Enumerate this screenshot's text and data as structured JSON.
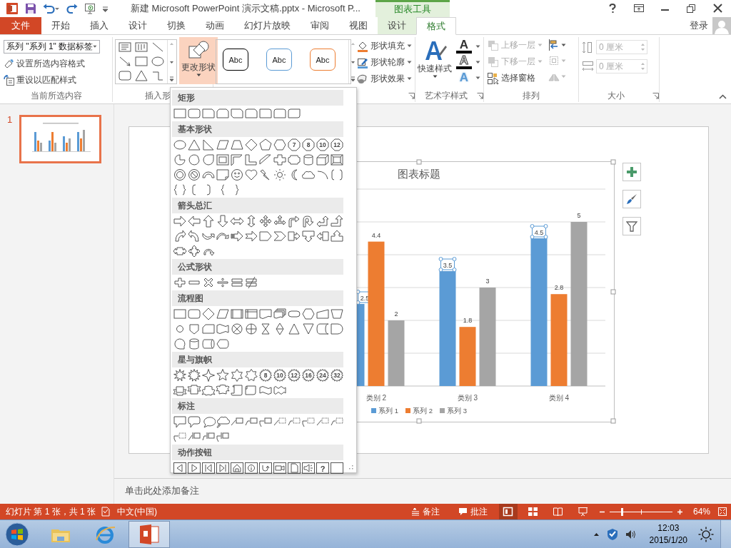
{
  "title_bar": {
    "title": "新建 Microsoft PowerPoint 演示文稿.pptx - Microsoft P...",
    "context_group": "图表工具"
  },
  "tabs": [
    {
      "label": "文件",
      "kind": "file",
      "selected": false
    },
    {
      "label": "开始",
      "kind": "normal",
      "selected": false
    },
    {
      "label": "插入",
      "kind": "normal",
      "selected": false
    },
    {
      "label": "设计",
      "kind": "normal",
      "selected": false
    },
    {
      "label": "切换",
      "kind": "normal",
      "selected": false
    },
    {
      "label": "动画",
      "kind": "normal",
      "selected": false
    },
    {
      "label": "幻灯片放映",
      "kind": "normal",
      "selected": false
    },
    {
      "label": "审阅",
      "kind": "normal",
      "selected": false
    },
    {
      "label": "视图",
      "kind": "normal",
      "selected": false
    },
    {
      "label": "设计",
      "kind": "context",
      "selected": false
    },
    {
      "label": "格式",
      "kind": "context",
      "selected": true
    }
  ],
  "account": {
    "label": "登录"
  },
  "ribbon": {
    "current_selection": {
      "dropdown": "系列 \"系列 1\" 数据标签",
      "commands": [
        {
          "label": "设置所选内容格式",
          "kind": "format"
        },
        {
          "label": "重设以匹配样式",
          "kind": "reset"
        }
      ],
      "label": "当前所选内容"
    },
    "insert_shapes": {
      "change_shape": {
        "label": "更改形状",
        "pressed": true
      },
      "label": "插入形"
    },
    "shape_styles": {
      "presets": [
        {
          "text": "Abc",
          "color": "#000000"
        },
        {
          "text": "Abc",
          "color": "#5b9bd5"
        },
        {
          "text": "Abc",
          "color": "#ed7d31"
        }
      ],
      "commands": [
        {
          "label": "形状填充",
          "kind": "fill"
        },
        {
          "label": "形状轮廓",
          "kind": "outline"
        },
        {
          "label": "形状效果",
          "kind": "effects"
        }
      ]
    },
    "wordart": {
      "quick_styles": "快速样式",
      "text_buttons": [
        {
          "glyph": "A",
          "kind": "fill"
        },
        {
          "glyph": "A",
          "kind": "outline"
        },
        {
          "glyph": "A",
          "kind": "effects"
        }
      ],
      "label": "艺术字样式"
    },
    "arrange": {
      "commands": [
        {
          "label": "上移一层",
          "kind": "forward",
          "disabled": true
        },
        {
          "label": "下移一层",
          "kind": "backward",
          "disabled": true
        },
        {
          "label": "选择窗格",
          "kind": "pane",
          "disabled": false
        }
      ],
      "tools": [
        {
          "kind": "align",
          "disabled": false
        },
        {
          "kind": "group",
          "disabled": true
        },
        {
          "kind": "rotate",
          "disabled": true
        }
      ],
      "label": "排列"
    },
    "size": {
      "fields": [
        {
          "kind": "height",
          "value": "0 厘米",
          "disabled": true
        },
        {
          "kind": "width",
          "value": "0 厘米",
          "disabled": true
        }
      ],
      "label": "大小"
    }
  },
  "shape_gallery": {
    "sections": [
      {
        "title": "矩形"
      },
      {
        "title": "基本形状",
        "labels": [
          "7",
          "8",
          "10",
          "12"
        ]
      },
      {
        "title": "箭头总汇"
      },
      {
        "title": "公式形状"
      },
      {
        "title": "流程图"
      },
      {
        "title": "星与旗帜",
        "labels": [
          "8",
          "10",
          "12",
          "16",
          "24",
          "32"
        ]
      },
      {
        "title": "标注"
      },
      {
        "title": "动作按钮",
        "labels": [
          "?"
        ]
      }
    ]
  },
  "slides": [
    {
      "number": "1",
      "selected": true
    }
  ],
  "chart": {
    "selected": true,
    "label_selection": [
      true,
      false,
      false
    ],
    "chart_data": {
      "type": "bar",
      "title": "图表标题",
      "categories": [
        "类别 2",
        "类别 3",
        "类别 4"
      ],
      "series": [
        {
          "name": "系列 1",
          "color": "#5b9bd5",
          "values": [
            2.5,
            3.5,
            4.5
          ]
        },
        {
          "name": "系列 2",
          "color": "#ed7d31",
          "values": [
            4.4,
            1.8,
            2.8
          ]
        },
        {
          "name": "系列 3",
          "color": "#a5a5a5",
          "values": [
            2,
            3,
            5
          ]
        }
      ],
      "ylim": [
        0,
        6
      ],
      "data_labels": true,
      "legend": "bottom"
    }
  },
  "notes": {
    "prompt": "单击此处添加备注"
  },
  "status_bar": {
    "slide_info": "幻灯片 第 1 张，共 1 张",
    "language": "中文(中国)",
    "notes": "备注",
    "comments": "批注",
    "views": [
      {
        "kind": "normal",
        "selected": true
      },
      {
        "kind": "sorter",
        "selected": false
      },
      {
        "kind": "reading",
        "selected": false
      },
      {
        "kind": "show",
        "selected": false
      }
    ],
    "zoom": {
      "level": 0.2,
      "reading": "64%"
    }
  },
  "taskbar": {
    "apps": [
      {
        "kind": "explorer",
        "selected": false
      },
      {
        "kind": "browser",
        "selected": false
      },
      {
        "kind": "powerpoint",
        "selected": true
      }
    ],
    "time": "12:03",
    "date": "2015/1/20"
  }
}
